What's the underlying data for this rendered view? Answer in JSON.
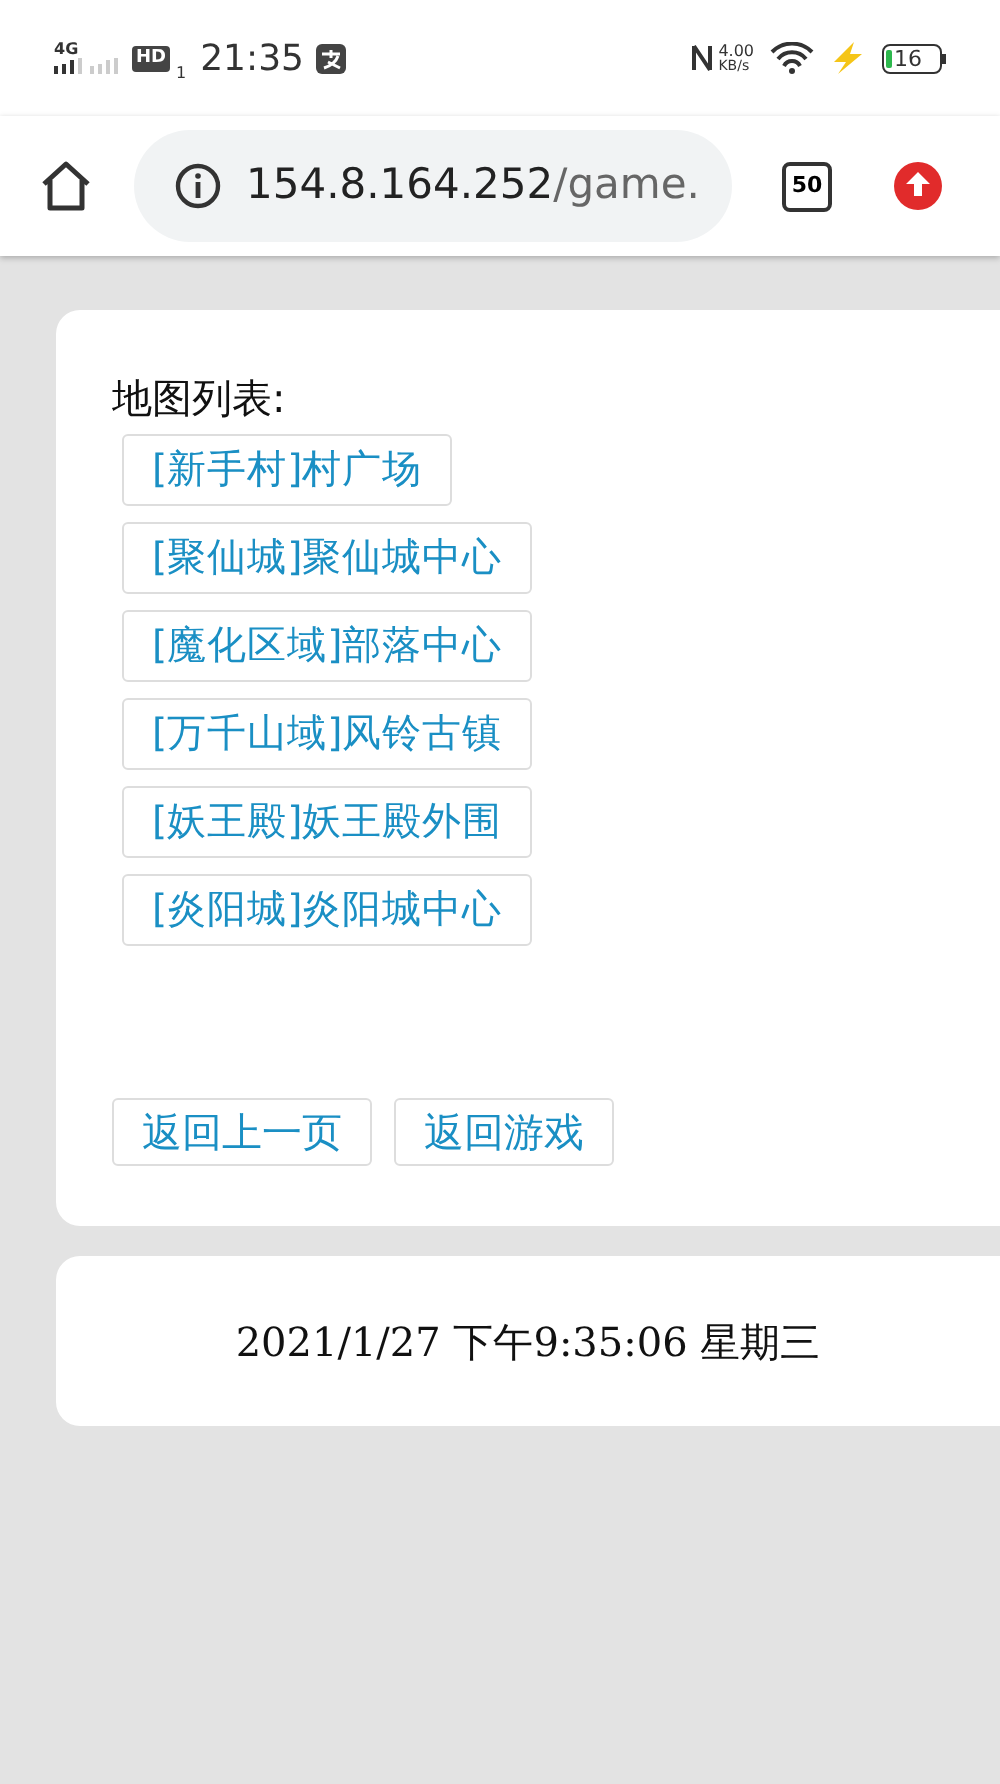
{
  "status_bar": {
    "network": "4G",
    "hd": "HD",
    "sim": "1",
    "time": "21:35",
    "speed": "4.00",
    "speed_unit": "KB/s",
    "battery": "16"
  },
  "browser": {
    "url_host": "154.8.164.252",
    "url_path": "/game.",
    "tab_count": "50"
  },
  "map_list": {
    "title": "地图列表:",
    "maps": [
      {
        "label": "[新手村]村广场"
      },
      {
        "label": "[聚仙城]聚仙城中心"
      },
      {
        "label": "[魔化区域]部落中心"
      },
      {
        "label": "[万千山域]风铃古镇"
      },
      {
        "label": "[妖王殿]妖王殿外围"
      },
      {
        "label": "[炎阳城]炎阳城中心"
      }
    ],
    "actions": [
      "返回上一页",
      "返回游戏"
    ]
  },
  "clock": {
    "text": "2021/1/27 下午9:35:06 星期三"
  }
}
